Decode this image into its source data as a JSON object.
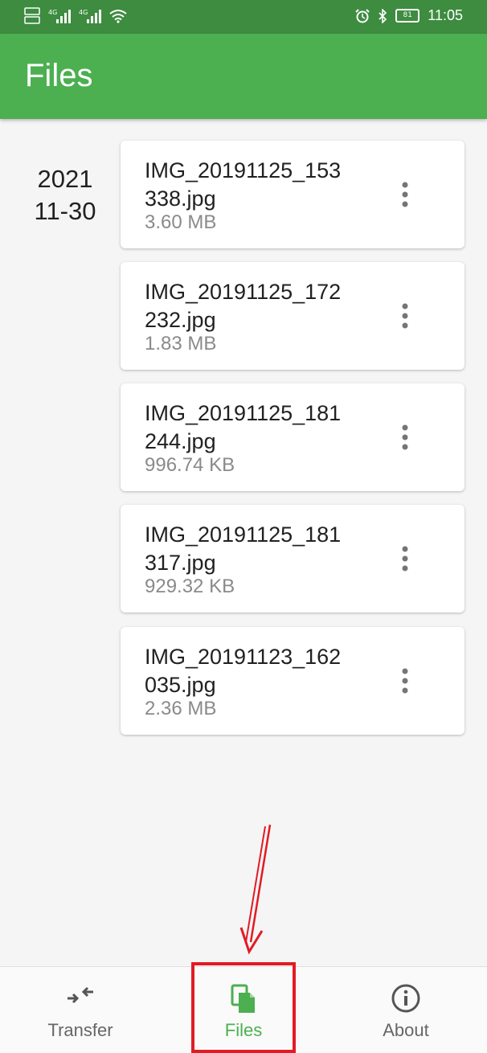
{
  "status_bar": {
    "time": "11:05",
    "battery": "81",
    "left_icons": [
      "hd-icon",
      "signal-4g-icon",
      "signal-4g-icon",
      "wifi-icon"
    ],
    "right_icons": [
      "alarm-icon",
      "bluetooth-icon",
      "battery-icon"
    ]
  },
  "app_bar": {
    "title": "Files"
  },
  "date_group": {
    "year": "2021",
    "monthday": "11-30"
  },
  "files": [
    {
      "name": "IMG_20191125_153338.jpg",
      "size": "3.60 MB"
    },
    {
      "name": "IMG_20191125_172232.jpg",
      "size": "1.83 MB"
    },
    {
      "name": "IMG_20191125_181244.jpg",
      "size": "996.74 KB"
    },
    {
      "name": "IMG_20191125_181317.jpg",
      "size": "929.32 KB"
    },
    {
      "name": "IMG_20191123_162035.jpg",
      "size": "2.36 MB"
    }
  ],
  "bottom_nav": {
    "items": [
      {
        "label": "Transfer",
        "icon": "transfer-icon",
        "active": false
      },
      {
        "label": "Files",
        "icon": "files-icon",
        "active": true
      },
      {
        "label": "About",
        "icon": "info-icon",
        "active": false
      }
    ]
  },
  "colors": {
    "status_bar": "#3d8c40",
    "app_bar": "#4caf50",
    "accent": "#4caf50",
    "annotation": "#e21b23"
  }
}
